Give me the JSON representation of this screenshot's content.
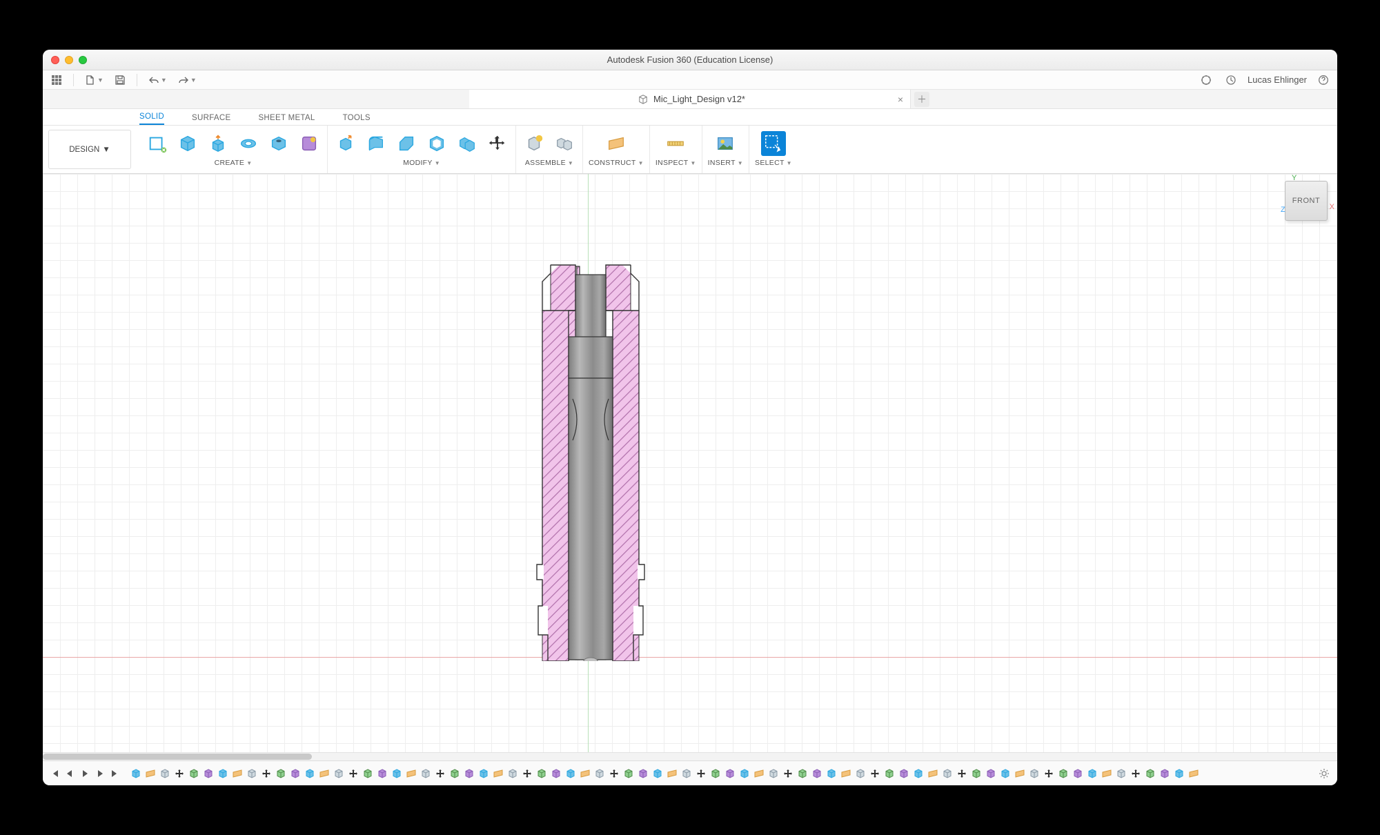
{
  "window": {
    "title": "Autodesk Fusion 360 (Education License)"
  },
  "document": {
    "name": "Mic_Light_Design v12*"
  },
  "user": {
    "name": "Lucas Ehlinger"
  },
  "workspace": {
    "label": "DESIGN"
  },
  "ribbonTabs": [
    "SOLID",
    "SURFACE",
    "SHEET METAL",
    "TOOLS"
  ],
  "activeRibbonTab": "SOLID",
  "panels": {
    "create": "CREATE",
    "modify": "MODIFY",
    "assemble": "ASSEMBLE",
    "construct": "CONSTRUCT",
    "inspect": "INSPECT",
    "insert": "INSERT",
    "select": "SELECT"
  },
  "viewcube": {
    "face": "FRONT",
    "axes": {
      "x": "X",
      "y": "Y",
      "z": "Z"
    }
  },
  "timelineFeatureCount": 74
}
